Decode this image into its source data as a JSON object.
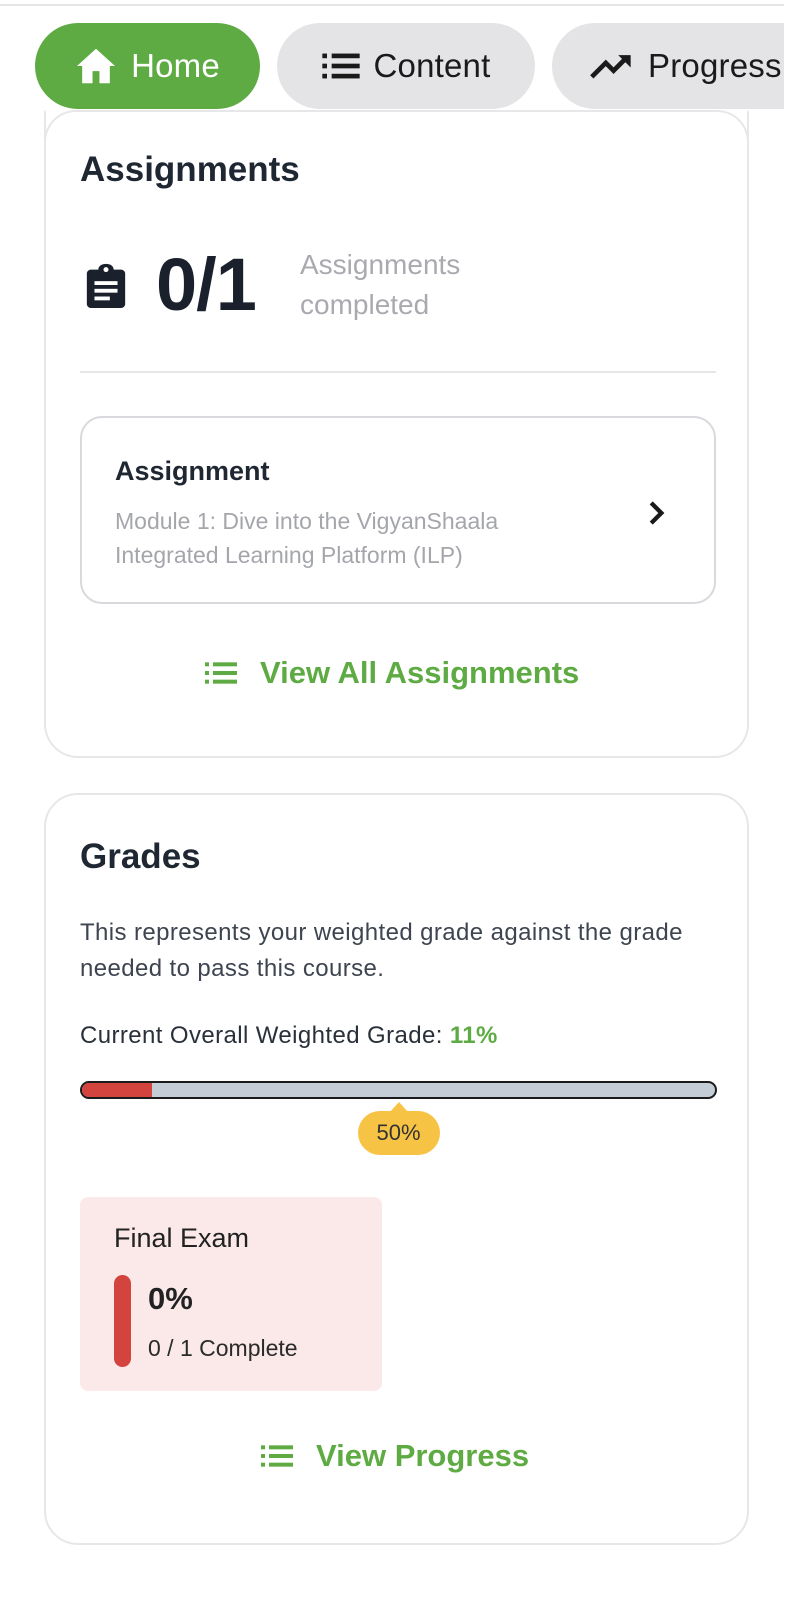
{
  "tabs": [
    {
      "label": "Home",
      "icon": "home-icon",
      "active": true
    },
    {
      "label": "Content",
      "icon": "list-icon",
      "active": false
    },
    {
      "label": "Progress",
      "icon": "trending-up-icon",
      "active": false
    }
  ],
  "assignments": {
    "title": "Assignments",
    "stat_value": "0/1",
    "stat_label": "Assignments completed",
    "item": {
      "title": "Assignment",
      "subtitle": "Module 1: Dive into the VigyanShaala Integrated Learning Platform (ILP)"
    },
    "view_all_label": "View All Assignments"
  },
  "grades": {
    "title": "Grades",
    "description": "This represents your weighted grade against the grade needed to pass this course.",
    "overall_label": "Current Overall Weighted Grade:",
    "overall_value": "11%",
    "current_fraction": 0.11,
    "pass_fraction": 0.5,
    "pass_label": "50%",
    "final_exam": {
      "label": "Final Exam",
      "percent": "0%",
      "complete": "0 / 1 Complete"
    },
    "view_progress_label": "View Progress"
  },
  "colors": {
    "accent_green": "#5eab43",
    "fail_red": "#d4443f",
    "pass_yellow": "#f7c344"
  }
}
